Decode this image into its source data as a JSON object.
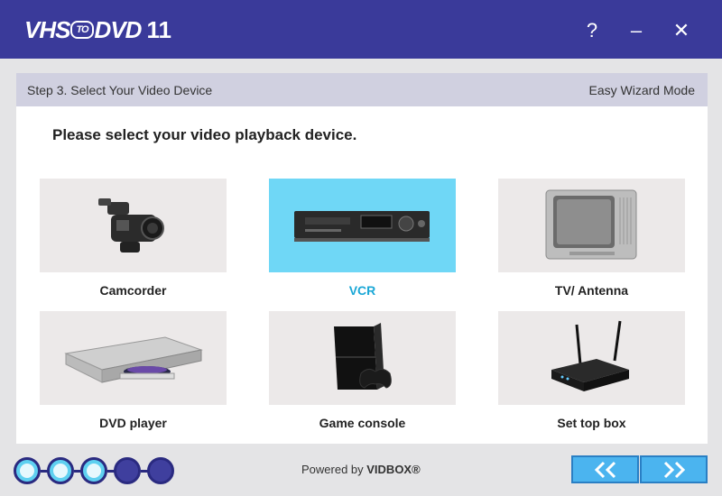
{
  "app": {
    "logo_vhs": "VHS",
    "logo_to": "TO",
    "logo_dvd": "DVD",
    "logo_version": "11"
  },
  "titlebar": {
    "help": "?",
    "minimize": "–",
    "close": "✕"
  },
  "stepbar": {
    "step": "Step 3. Select Your Video Device",
    "mode": "Easy Wizard Mode"
  },
  "main": {
    "heading": "Please select your video playback device.",
    "devices": [
      {
        "label": "Camcorder",
        "icon": "camcorder-icon"
      },
      {
        "label": "VCR",
        "icon": "vcr-icon",
        "selected": true
      },
      {
        "label": "TV/ Antenna",
        "icon": "tv-icon"
      },
      {
        "label": "DVD player",
        "icon": "dvd-player-icon"
      },
      {
        "label": "Game console",
        "icon": "game-console-icon"
      },
      {
        "label": "Set top box",
        "icon": "set-top-box-icon"
      }
    ]
  },
  "footer": {
    "powered_prefix": "Powered by ",
    "powered_brand": "VIDBOX®",
    "progress": {
      "completed_steps": 3,
      "total_steps": 5
    },
    "back_icon": "double-chevron-left-icon",
    "next_icon": "double-chevron-right-icon"
  },
  "colors": {
    "titlebar": "#3a3a9a",
    "selected_tile": "#6fd7f6",
    "selected_label": "#1aa7d6",
    "nav_button": "#4bb4ef"
  }
}
